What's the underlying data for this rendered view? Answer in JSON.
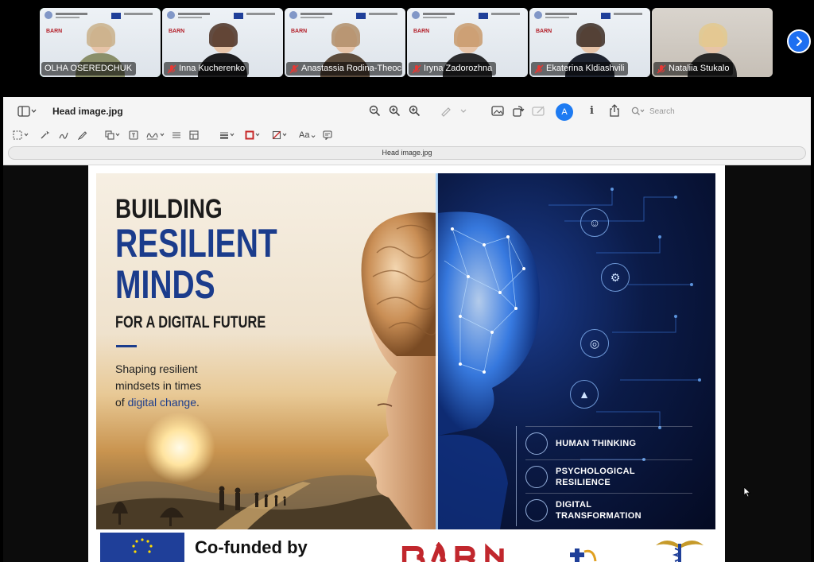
{
  "participants": [
    {
      "name": "OLHA OSEREDCHUK",
      "active": true,
      "muted": false,
      "bg": "poster",
      "hair": "#c9b08a",
      "body": "#8a8f6a"
    },
    {
      "name": "Inna Kucherenko",
      "active": false,
      "muted": true,
      "bg": "poster",
      "hair": "#4a2f22",
      "body": "#1d1d1f"
    },
    {
      "name": "Anastassia Rodina-Theocharaki",
      "active": false,
      "muted": true,
      "bg": "poster",
      "hair": "#b08e6a",
      "body": "#5b4b3c"
    },
    {
      "name": "Iryna Zadorozhna",
      "active": false,
      "muted": true,
      "bg": "poster",
      "hair": "#c89a6c",
      "body": "#2b2b2d"
    },
    {
      "name": "Ekaterina Kldiashvili",
      "active": false,
      "muted": true,
      "bg": "poster",
      "hair": "#3a2a22",
      "body": "#1f2430"
    },
    {
      "name": "Nataliia Stukalo",
      "active": false,
      "muted": true,
      "bg": "plain",
      "hair": "#e3c98e",
      "body": "#272727"
    }
  ],
  "viewer": {
    "window_title": "Head image.jpg",
    "file_bar_label": "Head image.jpg",
    "search_placeholder": "Search",
    "accessibility_label": "A"
  },
  "poster": {
    "line1": "BUILDING",
    "line2a": "RESILIENT",
    "line2b": "MINDS",
    "line3": "FOR A DIGITAL FUTURE",
    "tagline_1": "Shaping resilient",
    "tagline_2": "mindsets in times",
    "tagline_3": "of ",
    "tagline_highlight": "digital change",
    "tagline_end": ".",
    "features": [
      {
        "line1": "HUMAN THINKING",
        "line2": ""
      },
      {
        "line1": "PSYCHOLOGICAL",
        "line2": "RESILIENCE"
      },
      {
        "line1": "DIGITAL",
        "line2": "TRANSFORMATION"
      }
    ],
    "footer_cofund": "Co-funded by"
  },
  "colors": {
    "accent": "#1e7bf2",
    "active_speaker": "#1fd46a",
    "poster_blue": "#1b3c8c",
    "barn_red": "#c1272d"
  }
}
